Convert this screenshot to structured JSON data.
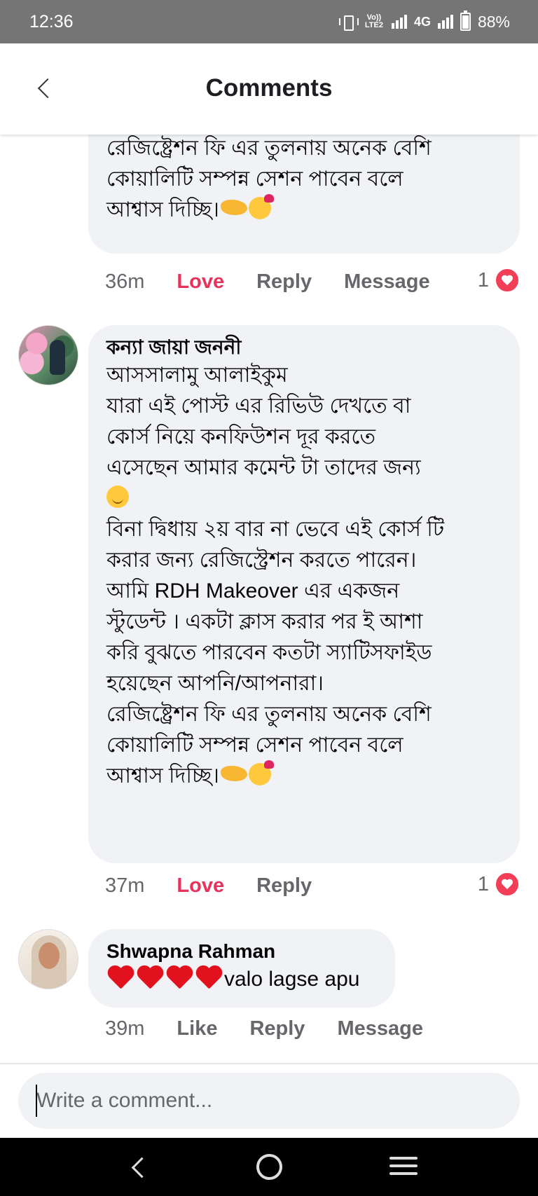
{
  "status_bar": {
    "time": "12:36",
    "volte_label": "Vo)) LTE2",
    "network_type": "4G",
    "battery_percent": "88%",
    "icons": [
      "vibrate-icon",
      "volte-icon",
      "signal-icon",
      "signal-icon-2",
      "battery-icon"
    ]
  },
  "header": {
    "title": "Comments",
    "back_icon": "chevron-left-icon"
  },
  "comments": [
    {
      "author": "",
      "lines": [
        "রেজিষ্ট্রেশন ফি এর তুলনায় অনেক বেশি",
        "কোয়ালিটি সম্পন্ন সেশন পাবেন বলে",
        "আশ্বাস দিচ্ছি।"
      ],
      "emojis": [
        "handshake-emoji",
        "smiling-face-with-hearts-emoji"
      ],
      "time": "36m",
      "actions": [
        "Love",
        "Reply",
        "Message"
      ],
      "reaction_count": "1",
      "reaction_icon": "love-reaction-icon"
    },
    {
      "author": "কন্যা জায়া জননী",
      "lines": [
        "আসসালামু আলাইকুম",
        "যারা এই পোস্ট এর রিভিউ দেখতে বা",
        "কোর্স নিয়ে কনফিউশন দূর করতে",
        "এসেছেন আমার কমেন্ট টা তাদের জন্য",
        "",
        "বিনা দ্বিধায় ২য় বার না ভেবে এই কোর্স টি",
        "করার জন্য রেজিস্ট্রেশন করতে পারেন।",
        "আমি RDH Makeover এর একজন",
        "স্টুডেন্ট । একটা ক্লাস করার পর ই আশা",
        "করি বুঝতে পারবেন কতটা স্যাটিসফাইড",
        "হয়েছেন আপনি/আপনারা।",
        "রেজিষ্ট্রেশন ফি এর তুলনায় অনেক বেশি",
        "কোয়ালিটি সম্পন্ন সেশন পাবেন বলে",
        "আশ্বাস দিচ্ছি।"
      ],
      "emojis": [
        "smiling-face-emoji",
        "handshake-emoji",
        "smiling-face-with-hearts-emoji"
      ],
      "time": "37m",
      "actions": [
        "Love",
        "Reply"
      ],
      "reaction_count": "1",
      "reaction_icon": "love-reaction-icon"
    },
    {
      "author": "Shwapna Rahman",
      "text": "valo lagse apu",
      "emojis": [
        "red-heart-emoji",
        "red-heart-emoji",
        "red-heart-emoji",
        "red-heart-emoji"
      ],
      "time": "39m",
      "actions": [
        "Like",
        "Reply",
        "Message"
      ]
    }
  ],
  "composer": {
    "placeholder": "Write a comment..."
  },
  "nav_bar": {
    "icons": [
      "nav-back-icon",
      "nav-home-icon",
      "nav-menu-icon"
    ]
  },
  "colors": {
    "status_bar_bg": "#757575",
    "bubble_bg": "#f0f2f5",
    "love_text": "#e7335c",
    "reaction_red": "#f33e58",
    "secondary_text": "#65676b",
    "nav_bar_bg": "#000000"
  }
}
